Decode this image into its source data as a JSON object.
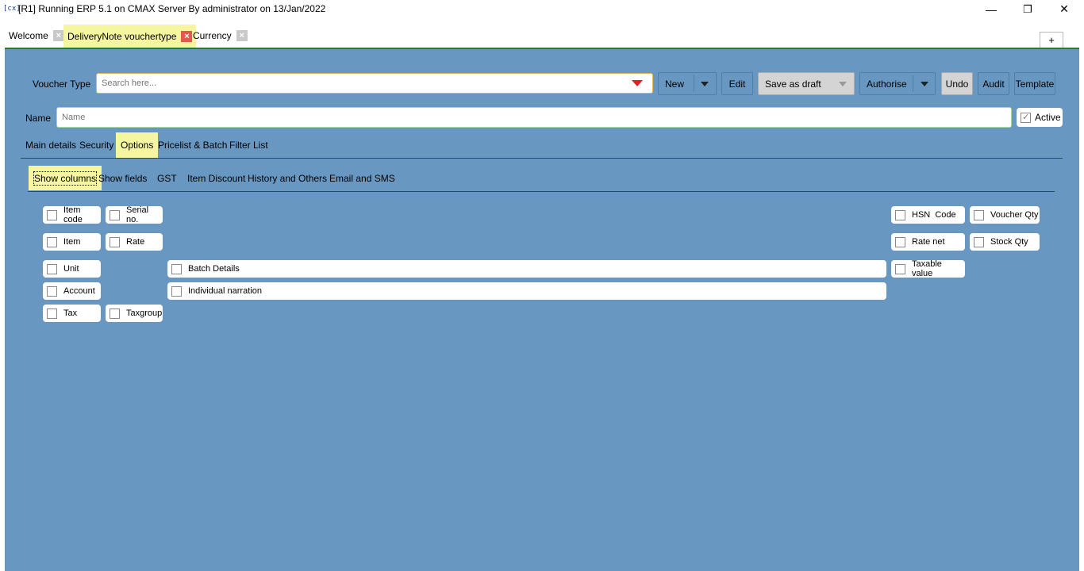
{
  "window": {
    "app_icon": "[cx]",
    "title": "[R1] Running ERP 5.1 on CMAX Server By administrator on 13/Jan/2022",
    "minimize_glyph": "—",
    "restore_glyph": "❐",
    "close_glyph": "✕"
  },
  "doc_tabs": [
    {
      "label": "Welcome",
      "close": "×"
    },
    {
      "label": "DeliveryNote vouchertype",
      "close": "×"
    },
    {
      "label": "Currency",
      "close": "×"
    }
  ],
  "plus_label": "+",
  "toolbar": {
    "voucher_type_label": "Voucher Type",
    "search_placeholder": "Search here...",
    "new_label": "New",
    "edit_label": "Edit",
    "save_draft_label": "Save as draft",
    "authorise_label": "Authorise",
    "undo_label": "Undo",
    "audit_label": "Audit",
    "template_label": "Template"
  },
  "name_row": {
    "label": "Name",
    "placeholder": "Name",
    "active_label": "Active",
    "active_checked": true
  },
  "main_tabs": [
    "Main details",
    "Security",
    "Options",
    "Pricelist & Batch",
    "Filter List"
  ],
  "sub_tabs": [
    "Show columns",
    "Show fields",
    "GST",
    "Item Discount",
    "History and Others",
    "Email and SMS"
  ],
  "columns": {
    "item_code": "Item code",
    "serial_no": "Serial no.",
    "item": "Item",
    "rate": "Rate",
    "unit": "Unit",
    "batch_details": "Batch Details",
    "account": "Account",
    "individual_narration": "Individual narration",
    "tax": "Tax",
    "taxgroup": "Taxgroup",
    "hsn_code": "HSN  Code",
    "voucher_qty": "Voucher Qty",
    "rate_net": "Rate net",
    "stock_qty": "Stock Qty",
    "taxable_value": "Taxable value"
  }
}
